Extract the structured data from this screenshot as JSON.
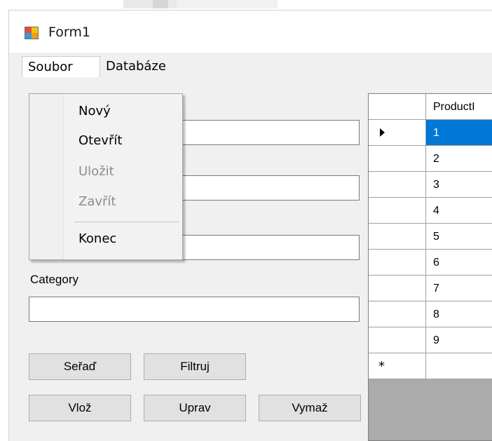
{
  "window": {
    "title": "Form1"
  },
  "menubar": {
    "items": [
      "Soubor",
      "Databáze"
    ]
  },
  "dropdown": {
    "items": [
      {
        "label": "Nový",
        "enabled": true
      },
      {
        "label": "Otevřít",
        "enabled": true
      },
      {
        "label": "Uložit",
        "enabled": false
      },
      {
        "label": "Zavřít",
        "enabled": false
      },
      {
        "label": "Konec",
        "enabled": true
      }
    ]
  },
  "form": {
    "category_label": "Category"
  },
  "buttons": {
    "sort": "Seřaď",
    "filter": "Filtruj",
    "insert": "Vlož",
    "edit": "Uprav",
    "delete": "Vymaž"
  },
  "grid": {
    "column_header": "ProductI",
    "rows": [
      "1",
      "2",
      "3",
      "4",
      "5",
      "6",
      "7",
      "8",
      "9"
    ],
    "selected_row": "1"
  },
  "colors": {
    "selection": "#0078d7",
    "disabled_text": "#8d8d8d"
  }
}
